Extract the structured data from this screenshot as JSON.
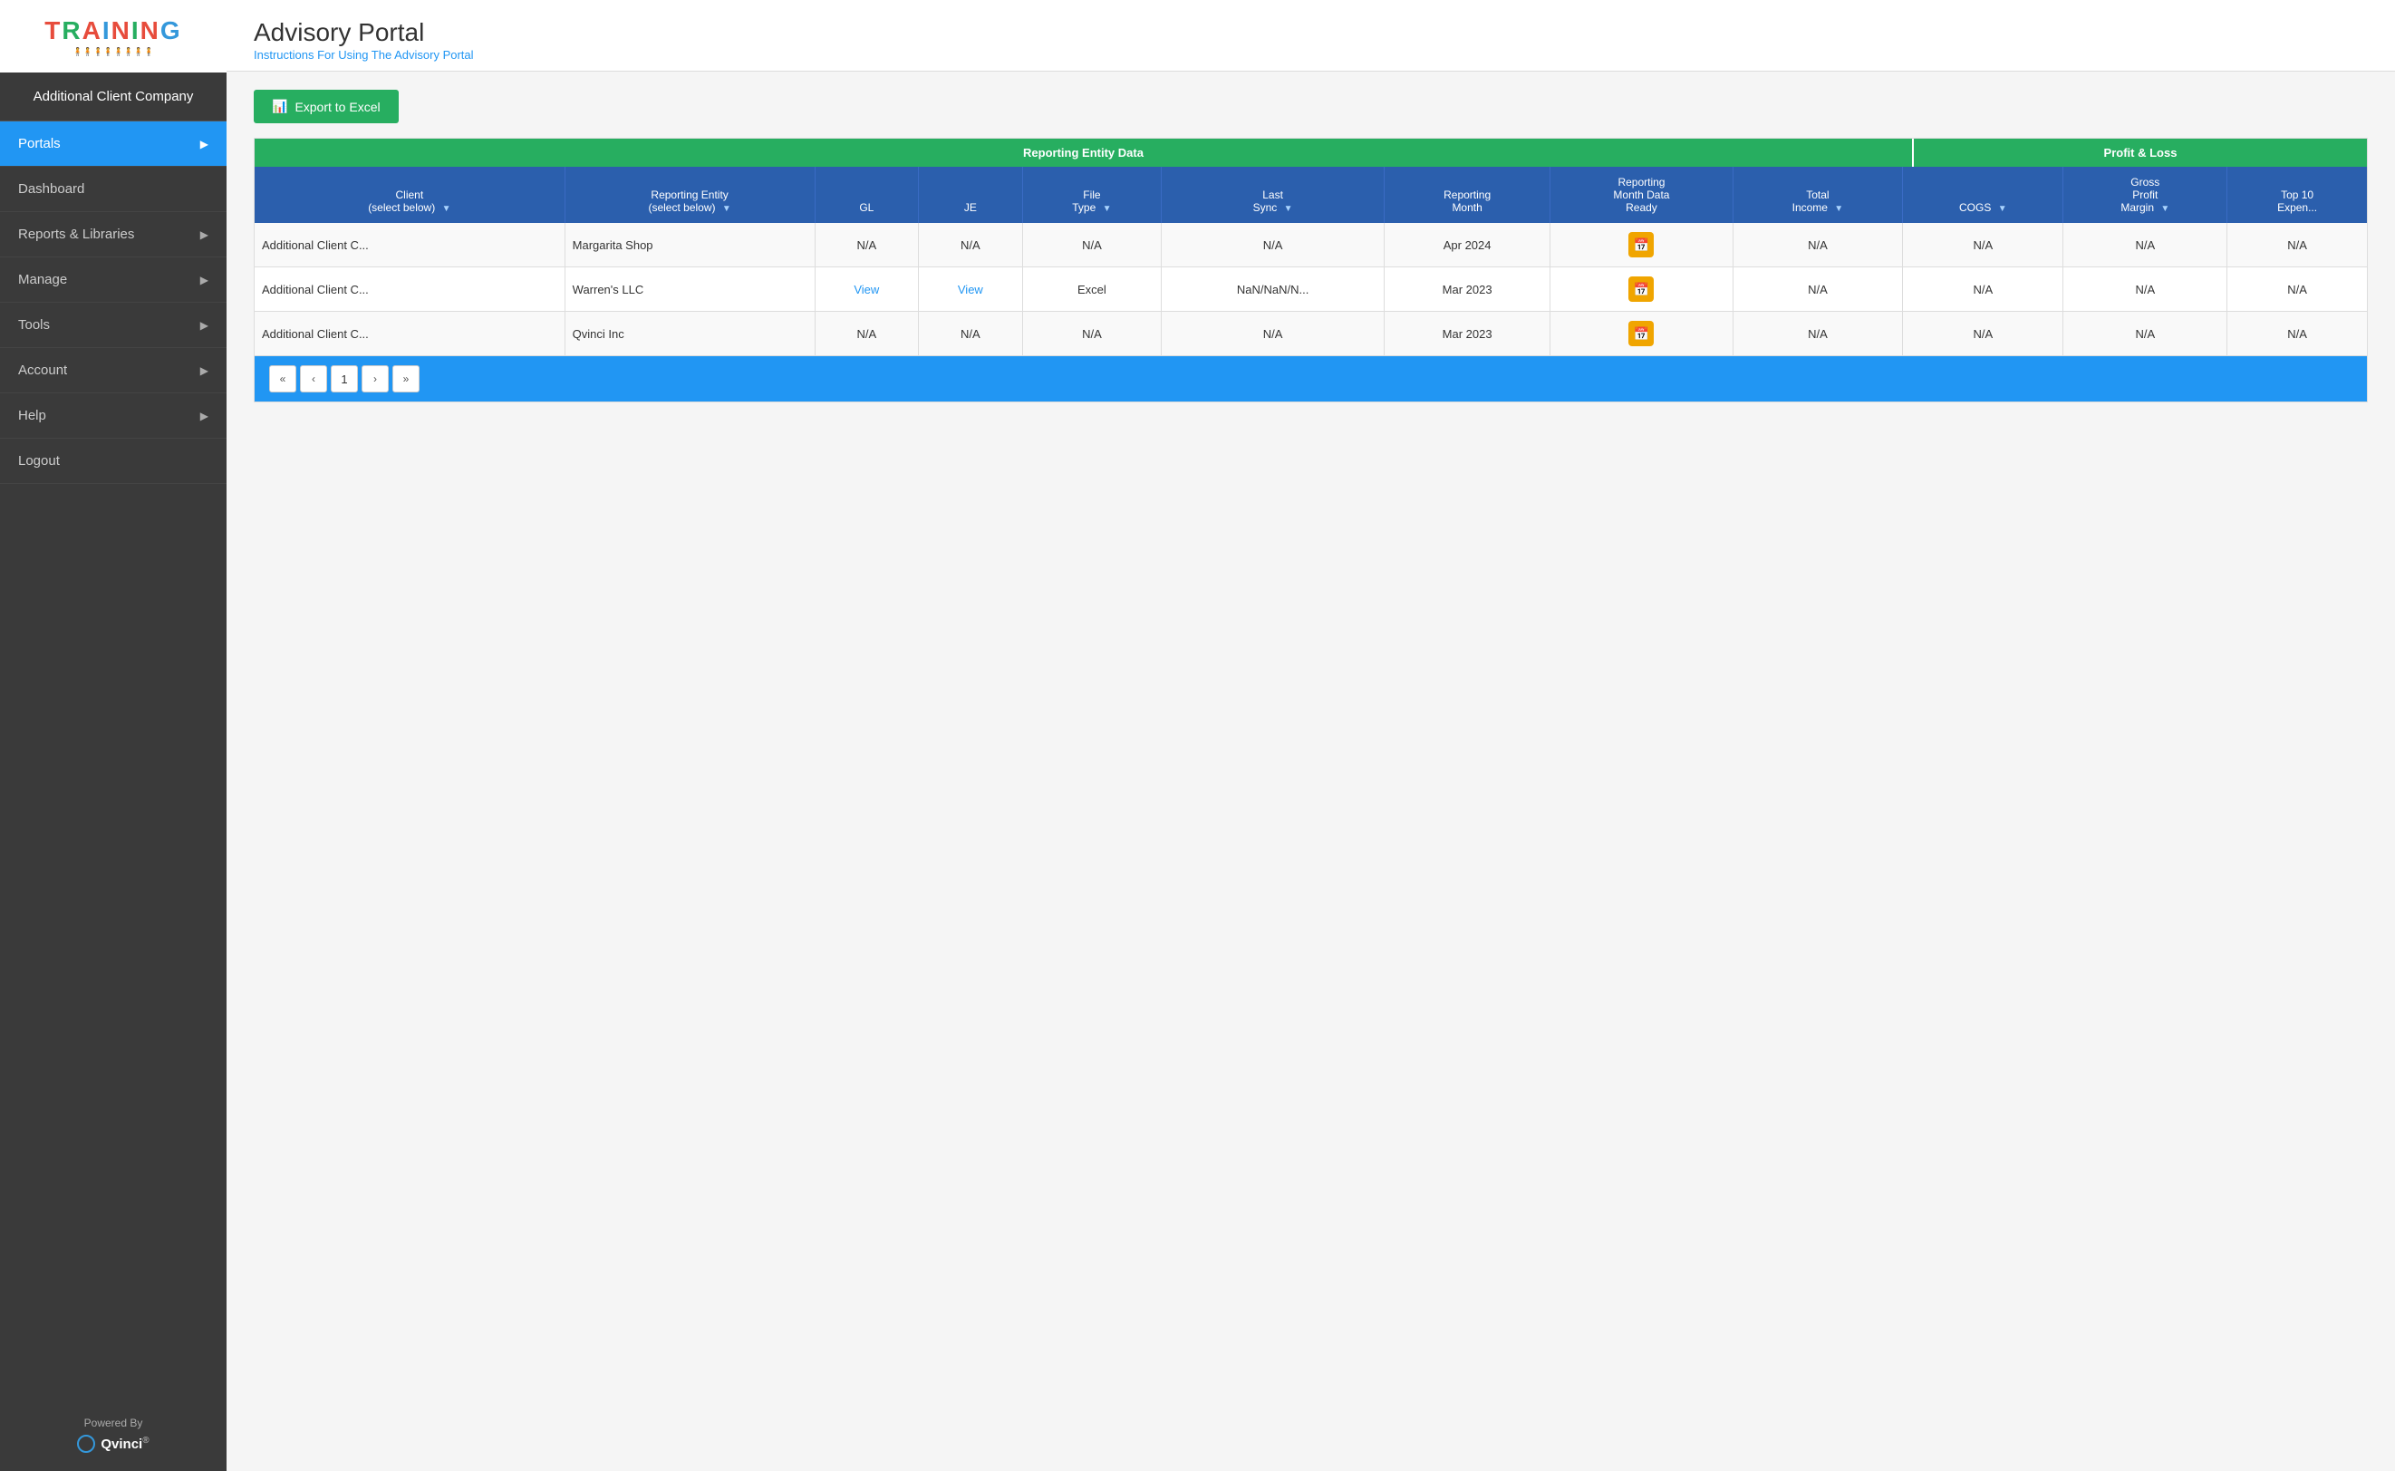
{
  "sidebar": {
    "client_name": "Additional Client Company",
    "logo_letters": [
      "T",
      "R",
      "A",
      "I",
      "N",
      "I",
      "N",
      "G"
    ],
    "powered_by": "Powered By",
    "brand": "Qvinci",
    "brand_reg": "®",
    "items": [
      {
        "id": "portals",
        "label": "Portals",
        "has_arrow": true,
        "active": true
      },
      {
        "id": "dashboard",
        "label": "Dashboard",
        "has_arrow": false,
        "active": false
      },
      {
        "id": "reports",
        "label": "Reports & Libraries",
        "has_arrow": true,
        "active": false
      },
      {
        "id": "manage",
        "label": "Manage",
        "has_arrow": true,
        "active": false
      },
      {
        "id": "tools",
        "label": "Tools",
        "has_arrow": true,
        "active": false
      },
      {
        "id": "account",
        "label": "Account",
        "has_arrow": true,
        "active": false
      },
      {
        "id": "help",
        "label": "Help",
        "has_arrow": true,
        "active": false
      },
      {
        "id": "logout",
        "label": "Logout",
        "has_arrow": false,
        "active": false
      }
    ]
  },
  "header": {
    "title": "Advisory Portal",
    "instructions_link": "Instructions For Using The Advisory Portal"
  },
  "toolbar": {
    "export_label": "Export to Excel"
  },
  "table": {
    "section_reporting": "Reporting Entity Data",
    "section_pnl": "Profit & Loss",
    "columns": [
      {
        "id": "client",
        "label": "Client\n(select below)",
        "has_filter": true
      },
      {
        "id": "reporting_entity",
        "label": "Reporting Entity\n(select below)",
        "has_filter": true
      },
      {
        "id": "gl",
        "label": "GL",
        "has_filter": false
      },
      {
        "id": "je",
        "label": "JE",
        "has_filter": false
      },
      {
        "id": "file_type",
        "label": "File\nType",
        "has_filter": true
      },
      {
        "id": "last_sync",
        "label": "Last\nSync",
        "has_filter": true
      },
      {
        "id": "reporting_month",
        "label": "Reporting\nMonth",
        "has_filter": false
      },
      {
        "id": "data_ready",
        "label": "Reporting\nMonth Data\nReady",
        "has_filter": false
      },
      {
        "id": "total_income",
        "label": "Total\nIncome",
        "has_filter": true
      },
      {
        "id": "cogs",
        "label": "COGS",
        "has_filter": true
      },
      {
        "id": "gross_profit_margin",
        "label": "Gross\nProfit\nMargin",
        "has_filter": true
      },
      {
        "id": "top10",
        "label": "Top 10\nExpen...",
        "has_filter": false
      }
    ],
    "rows": [
      {
        "client": "Additional Client C...",
        "reporting_entity": "Margarita Shop",
        "gl": "N/A",
        "je": "N/A",
        "file_type": "N/A",
        "last_sync": "N/A",
        "reporting_month": "Apr 2024",
        "data_ready": "calendar",
        "total_income": "N/A",
        "cogs": "N/A",
        "gross_profit_margin": "N/A",
        "top10": "N/A"
      },
      {
        "client": "Additional Client C...",
        "reporting_entity": "Warren's LLC",
        "gl": "View",
        "je": "View",
        "file_type": "Excel",
        "last_sync": "NaN/NaN/N...",
        "reporting_month": "Mar 2023",
        "data_ready": "calendar",
        "total_income": "N/A",
        "cogs": "N/A",
        "gross_profit_margin": "N/A",
        "top10": "N/A"
      },
      {
        "client": "Additional Client C...",
        "reporting_entity": "Qvinci Inc",
        "gl": "N/A",
        "je": "N/A",
        "file_type": "N/A",
        "last_sync": "N/A",
        "reporting_month": "Mar 2023",
        "data_ready": "calendar",
        "total_income": "N/A",
        "cogs": "N/A",
        "gross_profit_margin": "N/A",
        "top10": "N/A"
      }
    ],
    "calendar_icon": "📅"
  },
  "pagination": {
    "current_page": 1,
    "first_label": "«",
    "prev_label": "‹",
    "next_label": "›",
    "last_label": "»"
  }
}
